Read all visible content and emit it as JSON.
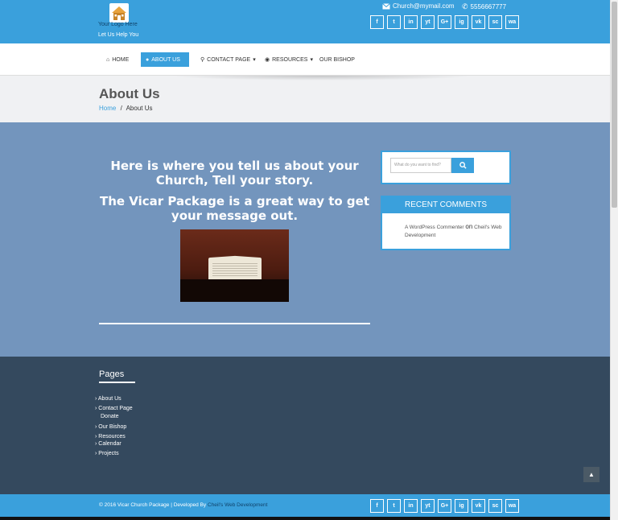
{
  "header": {
    "logo_text": "Your Logo Here",
    "tagline": "Let Us Help You",
    "email": "Church@mymail.com",
    "phone": "5556667777",
    "socials": [
      "f",
      "t",
      "in",
      "yt",
      "G+",
      "ig",
      "vk",
      "sc",
      "wa"
    ]
  },
  "nav": {
    "items": [
      {
        "label": "HOME",
        "icon": "home-icon"
      },
      {
        "label": "ABOUT US",
        "icon": "info-icon"
      },
      {
        "label": "CONTACT PAGE",
        "icon": "location-icon"
      },
      {
        "label": "RESOURCES",
        "icon": "resources-icon"
      },
      {
        "label": "OUR BISHOP",
        "icon": ""
      }
    ]
  },
  "page": {
    "title": "About Us",
    "breadcrumb_home": "Home",
    "breadcrumb_sep": "/",
    "breadcrumb_current": "About Us"
  },
  "content": {
    "headline1": "Here is where you tell us about your Church, Tell your story.",
    "headline2": "The Vicar Package is a great way to get your message out."
  },
  "sidebar": {
    "search_placeholder": "What do you want to find?",
    "recent_comments_title": "RECENT COMMENTS",
    "comment_author": "A WordPress Commenter",
    "comment_on": "on",
    "comment_post": "Cheil's Web Development"
  },
  "footer": {
    "pages_title": "Pages",
    "pages": [
      "About Us",
      "Contact Page",
      "Donate",
      "Our Bishop",
      "Resources",
      "Calendar",
      "Projects"
    ],
    "copyright": "© 2016 Vicar Church Package | Developed By",
    "developer": "Cheil's Web Development"
  },
  "colors": {
    "brand_blue": "#3aa0dc",
    "main_bg": "#7395bd",
    "footer_bg": "#34495e"
  }
}
